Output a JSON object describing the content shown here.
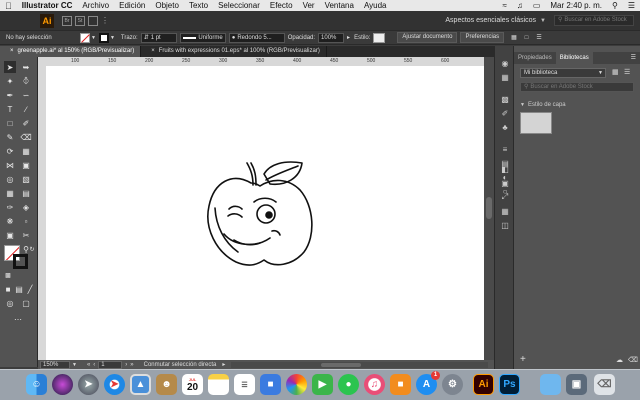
{
  "menubar": {
    "apple_icon": "apple-icon",
    "app_name": "Illustrator CC",
    "items": [
      "Archivo",
      "Edición",
      "Objeto",
      "Texto",
      "Seleccionar",
      "Efecto",
      "Ver",
      "Ventana",
      "Ayuda"
    ],
    "clock": "Mar 2:40 p. m."
  },
  "appbar": {
    "logo": "Ai",
    "workspace": "Aspectos esenciales clásicos",
    "stock_search_placeholder": "Buscar en Adobe Stock"
  },
  "control_bar": {
    "selection_label": "No hay selección",
    "stroke_label": "Trazo:",
    "stroke_value": "1 pt",
    "profile_label": "Uniforme",
    "brush_label": "Redondo 5...",
    "opacity_label": "Opacidad:",
    "opacity_value": "100%",
    "style_label": "Estilo:",
    "doc_setup_button": "Ajustar documento",
    "prefs_button": "Preferencias"
  },
  "tabs": [
    {
      "label": "greenapple.ai* al 150% (RGB/Previsualizar)",
      "active": true
    },
    {
      "label": "Fruits with expressions 01.eps* al 100% (RGB/Previsualizar)",
      "active": false
    }
  ],
  "ruler": {
    "ticks": [
      "100",
      "150",
      "200",
      "250",
      "300",
      "350",
      "400",
      "450",
      "500",
      "550",
      "600"
    ]
  },
  "status": {
    "zoom": "150%",
    "page": "1",
    "tool_hint": "Conmutar selección directa"
  },
  "panel": {
    "tab_properties": "Propiedades",
    "tab_libraries": "Bibliotecas",
    "library_select": "Mi biblioteca",
    "search_placeholder": "Buscar en Adobe Stock",
    "section_title": "Estilo de capa"
  },
  "dock": {
    "items": [
      "finder-icon",
      "siri-icon",
      "launchpad-icon",
      "safari-icon",
      "preview-icon",
      "contacts-icon",
      "calendar-icon",
      "notes-icon",
      "reminders-icon",
      "keynote-icon",
      "photos-icon",
      "facetime-icon",
      "messages-icon",
      "itunes-icon",
      "ibooks-icon",
      "appstore-icon",
      "system-preferences-icon",
      "illustrator-icon",
      "photoshop-icon",
      "folder-icon",
      "finder-window-icon",
      "trash-icon"
    ],
    "calendar_day": "20",
    "calendar_month": "JUL",
    "appstore_badge": "1",
    "illustrator_label": "Ai",
    "photoshop_label": "Ps"
  }
}
